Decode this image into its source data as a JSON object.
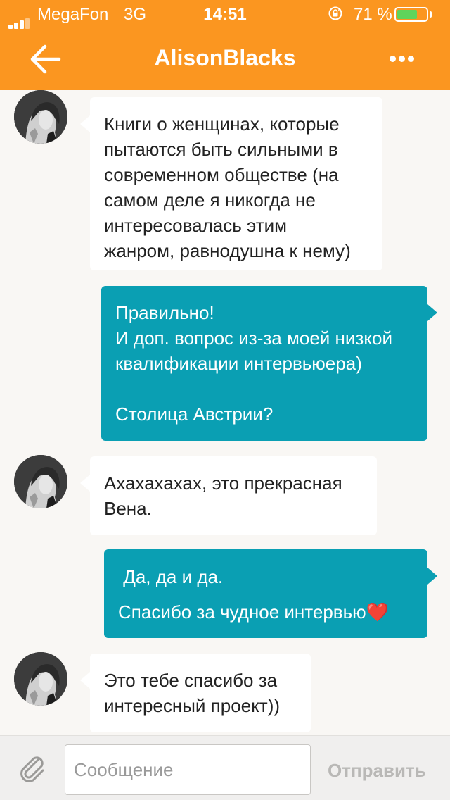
{
  "status_bar": {
    "carrier": "MegaFon",
    "network": "3G",
    "time": "14:51",
    "battery_percent": "71 %",
    "battery_level": 0.71,
    "icons": [
      "signal-icon",
      "rotation-lock-icon",
      "battery-icon"
    ]
  },
  "header": {
    "title": "AlisonBlacks",
    "back_icon": "arrow-left-icon",
    "more_icon": "more-dots-icon"
  },
  "messages": [
    {
      "direction": "incoming",
      "lines": [
        "Книги о женщинах, которые",
        "пытаются быть сильными в",
        "современном обществе (на",
        "самом деле я никогда не",
        "интересовалась этим",
        "жанром, равнодушна к нему)"
      ]
    },
    {
      "direction": "outgoing",
      "lines": [
        "Правильно!",
        "И доп. вопрос из-за моей низкой",
        "квалификации интервьюера)",
        "",
        "Столица Австрии?"
      ]
    },
    {
      "direction": "incoming",
      "lines": [
        "Ахахахахах, это прекрасная",
        "Вена."
      ]
    },
    {
      "direction": "outgoing",
      "lines": [
        " Да, да и да.",
        "Спасибо за чудное интервью"
      ],
      "emoji": "❤️"
    },
    {
      "direction": "incoming",
      "lines": [
        "Это тебе спасибо за",
        "интересный проект))"
      ]
    }
  ],
  "composer": {
    "placeholder": "Сообщение",
    "value": "",
    "send_label": "Отправить",
    "attach_icon": "paperclip-icon"
  },
  "colors": {
    "header_bg": "#fb9620",
    "outgoing_bubble": "#0a9fb3",
    "incoming_bubble": "#ffffff",
    "chat_bg": "#f9f7f4",
    "battery_fill": "#5fd45b"
  }
}
